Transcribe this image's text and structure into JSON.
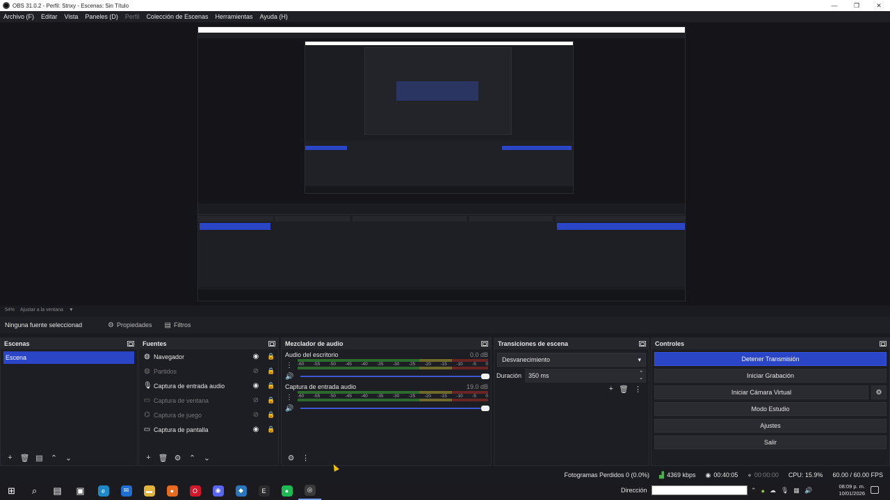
{
  "window": {
    "title": "OBS 31.0.2 - Perfil: Stnxy - Escenas: Sin Título",
    "buttons": [
      "—",
      "❐",
      "✕"
    ]
  },
  "menu": {
    "items": [
      {
        "label": "Archivo (F)",
        "enabled": true
      },
      {
        "label": "Editar",
        "enabled": true
      },
      {
        "label": "Vista",
        "enabled": true
      },
      {
        "label": "Paneles (D)",
        "enabled": true
      },
      {
        "label": "Perfil",
        "enabled": false
      },
      {
        "label": "Colección de Escenas",
        "enabled": true
      },
      {
        "label": "Herramientas",
        "enabled": true
      },
      {
        "label": "Ayuda (H)",
        "enabled": true
      }
    ]
  },
  "zoom": {
    "value": "54%",
    "mode": "Ajustar a la ventana",
    "arrow": "▼"
  },
  "source_toolbar": {
    "no_selection": "Ninguna fuente seleccionad",
    "properties": "Propiedades",
    "filters": "Filtros"
  },
  "scenes": {
    "title": "Escenas",
    "items": [
      "Escena"
    ]
  },
  "sources": {
    "title": "Fuentes",
    "items": [
      {
        "label": "Navegador",
        "icon": "globe-icon",
        "glyph": "◍",
        "visible": true
      },
      {
        "label": "Partidos",
        "icon": "globe-icon",
        "glyph": "◍",
        "visible": false
      },
      {
        "label": "Captura de entrada audio",
        "icon": "microphone-icon",
        "glyph": "🎙",
        "visible": true
      },
      {
        "label": "Captura de ventana",
        "icon": "window-icon",
        "glyph": "▭",
        "visible": false
      },
      {
        "label": "Captura de juego",
        "icon": "gamepad-icon",
        "glyph": "⌬",
        "visible": false
      },
      {
        "label": "Captura de pantalla",
        "icon": "monitor-icon",
        "glyph": "▭",
        "visible": true
      }
    ]
  },
  "mixer": {
    "title": "Mezclador de audio",
    "ticks": [
      "-60",
      "-55",
      "-50",
      "-45",
      "-40",
      "-35",
      "-30",
      "-25",
      "-20",
      "-15",
      "-10",
      "-5",
      "0"
    ],
    "channels": [
      {
        "name": "Audio del escritorio",
        "db": "0.0 dB",
        "level": 1.0
      },
      {
        "name": "Captura de entrada audio",
        "db": "19.0 dB",
        "level": 1.0
      }
    ]
  },
  "transitions": {
    "title": "Transiciones de escena",
    "selected": "Desvanecimiento",
    "duration_label": "Duración",
    "duration_value": "350 ms"
  },
  "controls": {
    "title": "Controles",
    "stop_stream": "Detener Transmisión",
    "start_recording": "Iniciar Grabación",
    "start_virtual_camera": "Iniciar Cámara Virtual",
    "studio_mode": "Modo Estudio",
    "settings": "Ajustes",
    "exit": "Salir"
  },
  "status": {
    "dropped_frames": "Fotogramas Perdidos 0 (0.0%)",
    "bitrate": "4369 kbps",
    "stream_time": "00:40:05",
    "rec_time": "00:00:00",
    "cpu": "CPU: 15.9%",
    "fps": "60.00 / 60.00 FPS"
  },
  "taskbar": {
    "apps": [
      {
        "name": "windows-start-icon",
        "glyph": "⊞",
        "color": "#ffffff"
      },
      {
        "name": "search-icon",
        "glyph": "⌕",
        "color": "#ffffff"
      },
      {
        "name": "task-view-icon",
        "glyph": "▤",
        "color": "#ffffff"
      },
      {
        "name": "store-icon",
        "glyph": "▣",
        "color": "#ffffff"
      },
      {
        "name": "edge-icon",
        "glyph": "e",
        "color": "#1e88c7"
      },
      {
        "name": "mail-icon",
        "glyph": "✉",
        "color": "#1e6fd0"
      },
      {
        "name": "folder-icon",
        "glyph": "▬",
        "color": "#e2b33a"
      },
      {
        "name": "firefox-icon",
        "glyph": "●",
        "color": "#e66a1f"
      },
      {
        "name": "opera-icon",
        "glyph": "O",
        "color": "#d1182b"
      },
      {
        "name": "discord-icon",
        "glyph": "◉",
        "color": "#5865f2"
      },
      {
        "name": "steam-icon",
        "glyph": "◆",
        "color": "#2a75bb"
      },
      {
        "name": "epic-games-icon",
        "glyph": "E",
        "color": "#2b2b2b"
      },
      {
        "name": "spotify-icon",
        "glyph": "●",
        "color": "#1db954"
      },
      {
        "name": "obs-icon",
        "glyph": "◎",
        "color": "#3a3a3a"
      }
    ],
    "address_label": "Dirección",
    "clock_time": "08:09 p. m.",
    "clock_date": "10/01/2026",
    "accent": "#2a46c7"
  }
}
